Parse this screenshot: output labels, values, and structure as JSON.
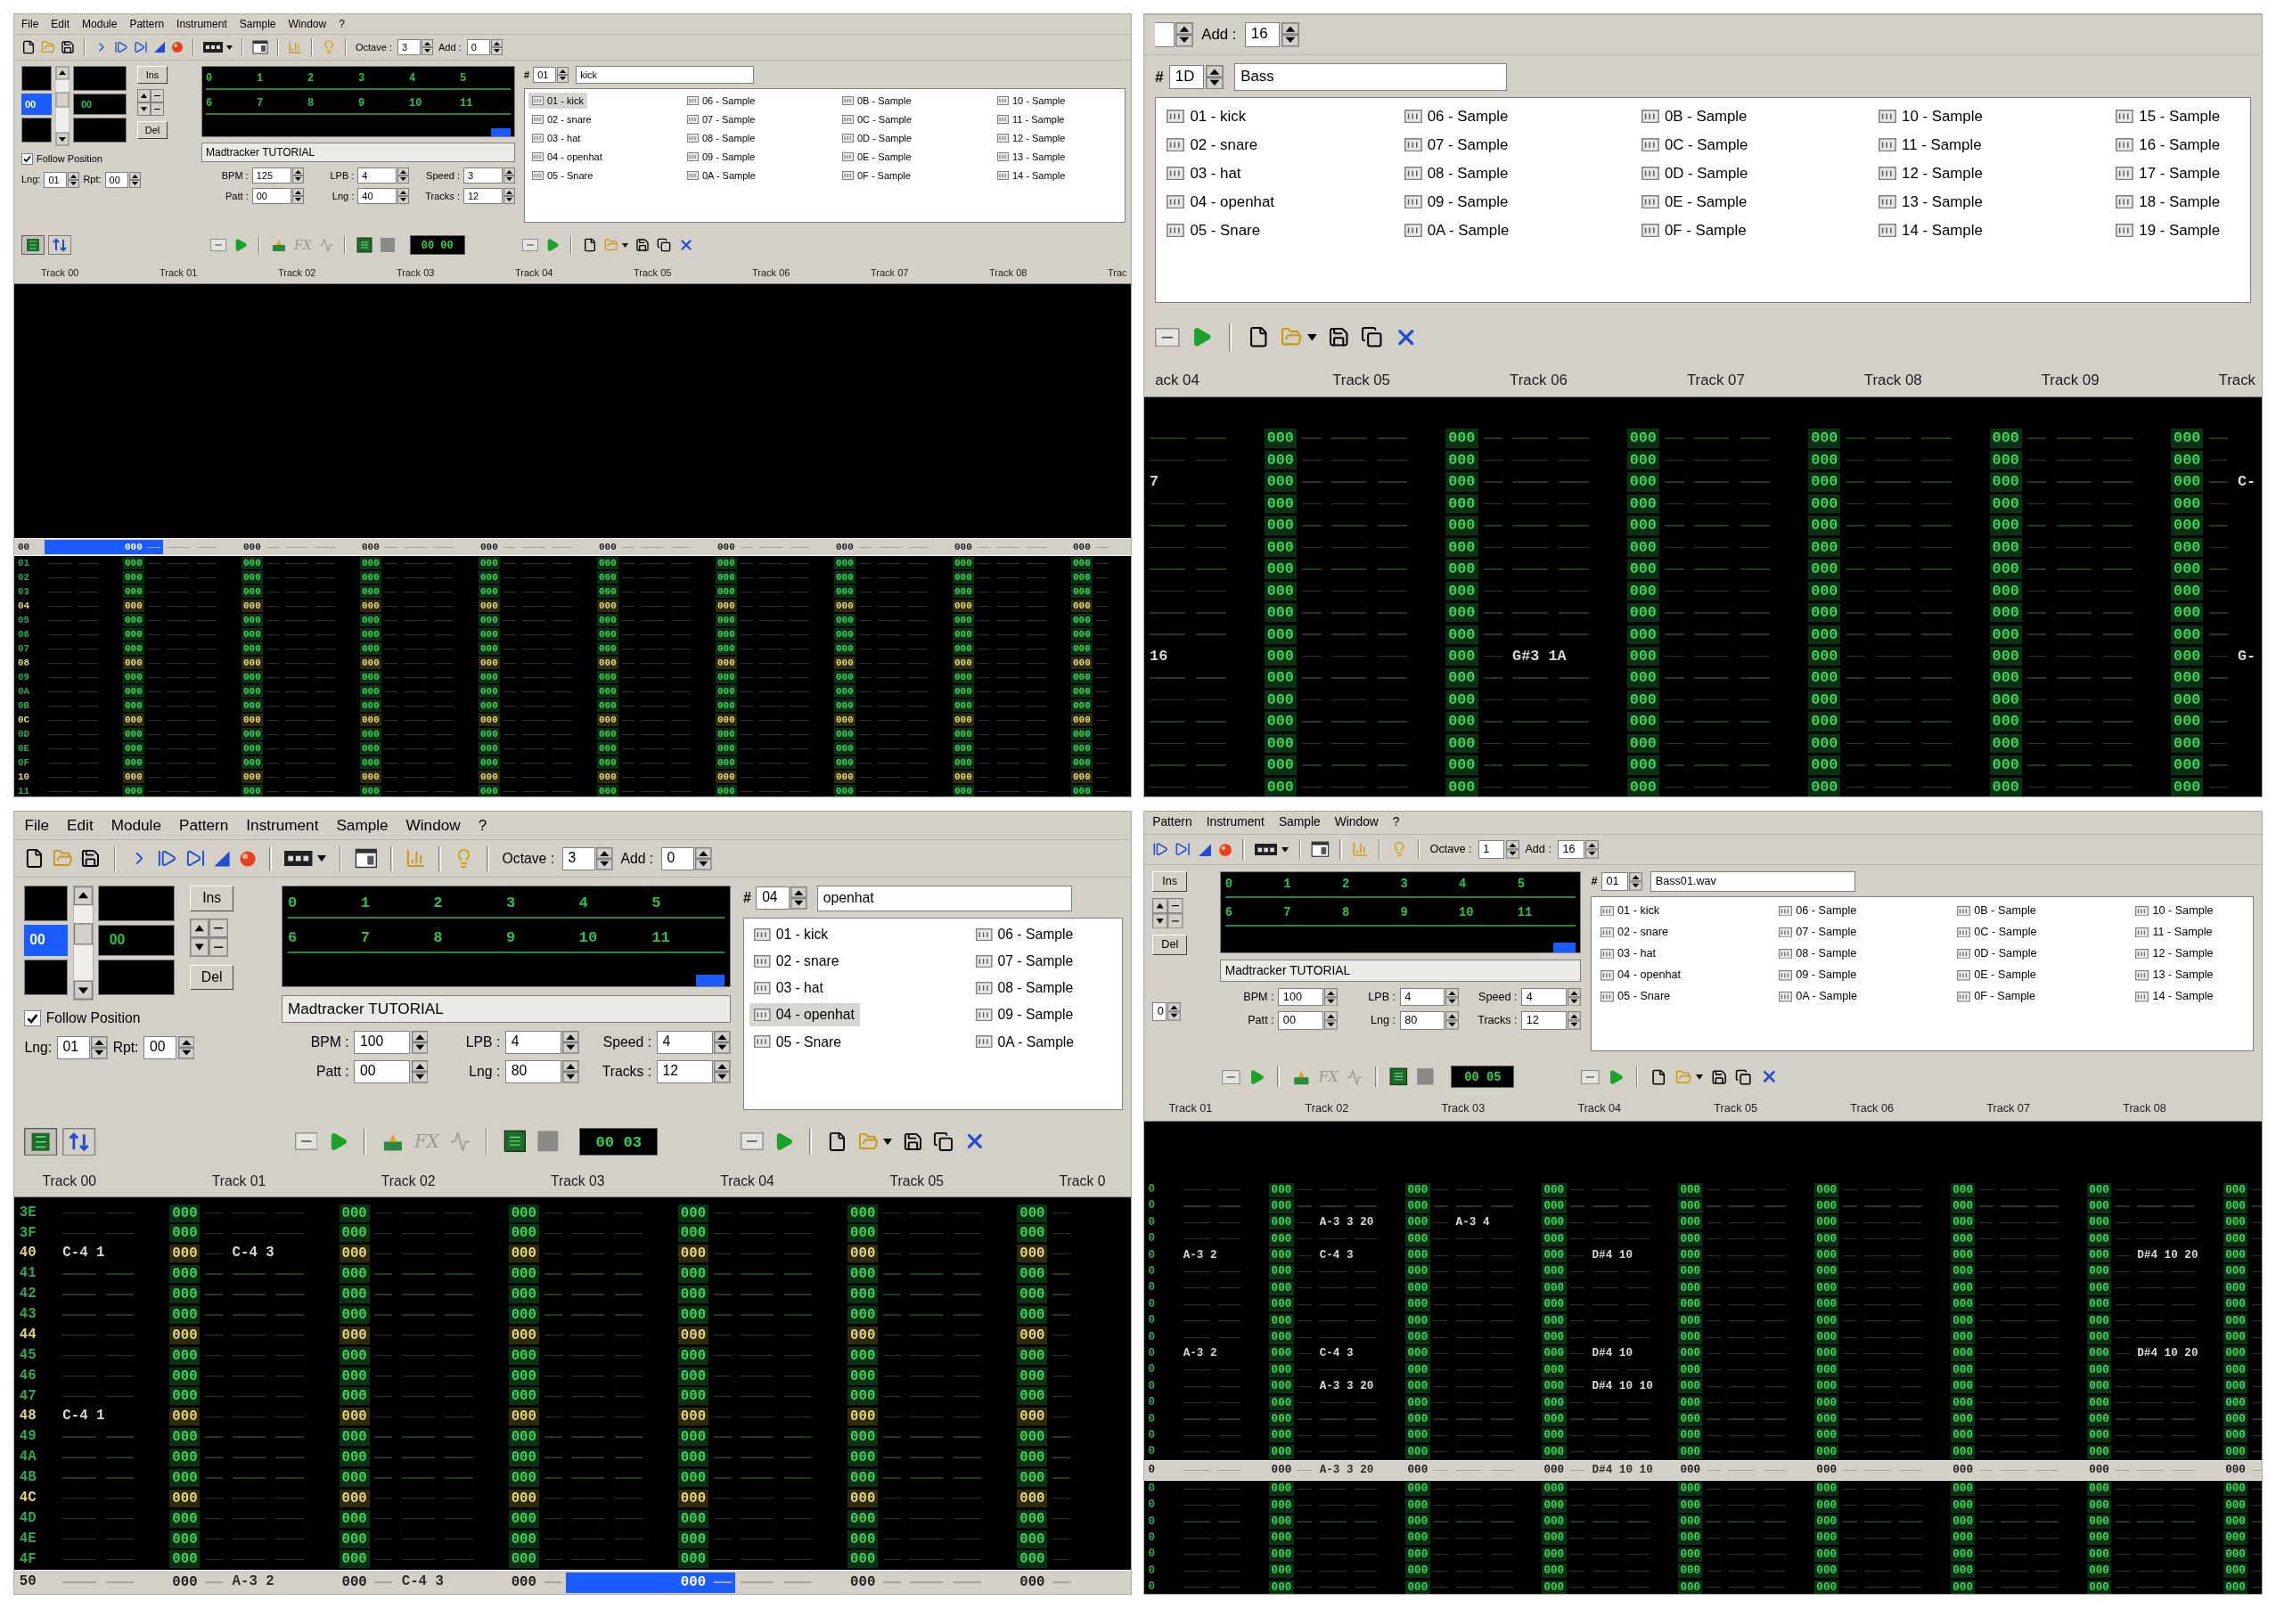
{
  "panels": [
    {
      "kind": "p1",
      "menu": [
        "File",
        "Edit",
        "Module",
        "Pattern",
        "Instrument",
        "Sample",
        "Window",
        "?"
      ],
      "toolbar": {
        "kind": "full",
        "octave_label": "Octave :",
        "octave": "3",
        "add_label": "Add :",
        "add": "0"
      },
      "controls": {
        "left": {
          "order_a": "00",
          "order_b": "00",
          "ins": "Ins",
          "del": "Del",
          "follow": {
            "label": "Follow Position",
            "checked": true
          },
          "lng_label": "Lng:",
          "lng": "01",
          "rpt_label": "Rpt:",
          "rpt": "00"
        },
        "song": {
          "orders": [
            "0",
            "1",
            "2",
            "3",
            "4",
            "5",
            "6",
            "7",
            "8",
            "9",
            "10",
            "11"
          ],
          "name": "Madtracker TUTORIAL",
          "params": [
            {
              "label": "BPM :",
              "value": "125"
            },
            {
              "label": "LPB :",
              "value": "4"
            },
            {
              "label": "Speed :",
              "value": "3"
            },
            {
              "label": "Patt :",
              "value": "00"
            },
            {
              "label": "Lng :",
              "value": "40"
            },
            {
              "label": "Tracks :",
              "value": "12"
            }
          ]
        },
        "instruments": {
          "number_label": "#",
          "number": "01",
          "name": "kick",
          "items": [
            {
              "label": "01 - kick",
              "selected": true
            },
            {
              "label": "02 - snare",
              "selected": false
            },
            {
              "label": "03 - hat",
              "selected": false
            },
            {
              "label": "04 - openhat",
              "selected": false
            },
            {
              "label": "05 - Snare",
              "selected": false
            },
            {
              "label": "06 - Sample",
              "selected": false
            },
            {
              "label": "07 - Sample",
              "selected": false
            },
            {
              "label": "08 - Sample",
              "selected": false
            },
            {
              "label": "09 - Sample",
              "selected": false
            },
            {
              "label": "0A - Sample",
              "selected": false
            },
            {
              "label": "0B - Sample",
              "selected": false
            },
            {
              "label": "0C - Sample",
              "selected": false
            },
            {
              "label": "0D - Sample",
              "selected": false
            },
            {
              "label": "0E - Sample",
              "selected": false
            },
            {
              "label": "0F - Sample",
              "selected": false
            },
            {
              "label": "10 - Sample",
              "selected": false
            },
            {
              "label": "11 - Sample",
              "selected": false
            },
            {
              "label": "12 - Sample",
              "selected": false
            },
            {
              "label": "13 - Sample",
              "selected": false
            },
            {
              "label": "14 - Sample",
              "selected": false
            }
          ]
        }
      },
      "toolbar2": {
        "kind": "full",
        "fx_label": "FX",
        "time": "00 00"
      },
      "headers": [
        "Track 00",
        "Track 01",
        "Track 02",
        "Track 03",
        "Track 04",
        "Track 05",
        "Track 06",
        "Track 07",
        "Track 08",
        "Trac"
      ],
      "pattern": {
        "current": {
          "num": "00",
          "cells": [
            {
              "kind": "cursor",
              "fx": "000"
            },
            "000",
            "000",
            "000",
            "000",
            "000",
            "000",
            "000",
            "000"
          ]
        },
        "rows_below": [
          {
            "num": "01",
            "highlight": false,
            "cells": [
              "000",
              "000",
              "000",
              "000",
              "000",
              "000",
              "000",
              "000",
              "000"
            ]
          },
          {
            "num": "02",
            "highlight": false,
            "cells": [
              "000",
              "000",
              "000",
              "000",
              "000",
              "000",
              "000",
              "000",
              "000"
            ]
          },
          {
            "num": "03",
            "highlight": false,
            "cells": [
              "000",
              "000",
              "000",
              "000",
              "000",
              "000",
              "000",
              "000",
              "000"
            ]
          },
          {
            "num": "04",
            "highlight": true,
            "cells": [
              "000",
              "000",
              "000",
              "000",
              "000",
              "000",
              "000",
              "000",
              "000"
            ]
          },
          {
            "num": "05",
            "highlight": false,
            "cells": [
              "000",
              "000",
              "000",
              "000",
              "000",
              "000",
              "000",
              "000",
              "000"
            ]
          },
          {
            "num": "06",
            "highlight": false,
            "cells": [
              "000",
              "000",
              "000",
              "000",
              "000",
              "000",
              "000",
              "000",
              "000"
            ]
          },
          {
            "num": "07",
            "highlight": false,
            "cells": [
              "000",
              "000",
              "000",
              "000",
              "000",
              "000",
              "000",
              "000",
              "000"
            ]
          },
          {
            "num": "08",
            "highlight": true,
            "cells": [
              "000",
              "000",
              "000",
              "000",
              "000",
              "000",
              "000",
              "000",
              "000"
            ]
          },
          {
            "num": "09",
            "highlight": false,
            "cells": [
              "000",
              "000",
              "000",
              "000",
              "000",
              "000",
              "000",
              "000",
              "000"
            ]
          },
          {
            "num": "0A",
            "highlight": false,
            "cells": [
              "000",
              "000",
              "000",
              "000",
              "000",
              "000",
              "000",
              "000",
              "000"
            ]
          },
          {
            "num": "0B",
            "highlight": false,
            "cells": [
              "000",
              "000",
              "000",
              "000",
              "000",
              "000",
              "000",
              "000",
              "000"
            ]
          },
          {
            "num": "0C",
            "highlight": true,
            "cells": [
              "000",
              "000",
              "000",
              "000",
              "000",
              "000",
              "000",
              "000",
              "000"
            ]
          },
          {
            "num": "0D",
            "highlight": false,
            "cells": [
              "000",
              "000",
              "000",
              "000",
              "000",
              "000",
              "000",
              "000",
              "000"
            ]
          },
          {
            "num": "0E",
            "highlight": false,
            "cells": [
              "000",
              "000",
              "000",
              "000",
              "000",
              "000",
              "000",
              "000",
              "000"
            ]
          },
          {
            "num": "0F",
            "highlight": false,
            "cells": [
              "000",
              "000",
              "000",
              "000",
              "000",
              "000",
              "000",
              "000",
              "000"
            ]
          },
          {
            "num": "10",
            "highlight": true,
            "cells": [
              "000",
              "000",
              "000",
              "000",
              "000",
              "000",
              "000",
              "000",
              "000"
            ]
          },
          {
            "num": "11",
            "highlight": false,
            "cells": [
              "000",
              "000",
              "000",
              "000",
              "000",
              "000",
              "000",
              "000",
              "000"
            ]
          }
        ]
      }
    },
    {
      "kind": "p2",
      "toolbar": {
        "kind": "add_only",
        "add_label": "Add :",
        "add": "16"
      },
      "controls": {
        "instruments": {
          "number_label": "#",
          "number": "1D",
          "name": "Bass",
          "items": [
            {
              "label": "01 - kick",
              "selected": false
            },
            {
              "label": "02 - snare",
              "selected": false
            },
            {
              "label": "03 - hat",
              "selected": false
            },
            {
              "label": "04 - openhat",
              "selected": false
            },
            {
              "label": "05 - Snare",
              "selected": false
            },
            {
              "label": "06 - Sample",
              "selected": false
            },
            {
              "label": "07 - Sample",
              "selected": false
            },
            {
              "label": "08 - Sample",
              "selected": false
            },
            {
              "label": "09 - Sample",
              "selected": false
            },
            {
              "label": "0A - Sample",
              "selected": false
            },
            {
              "label": "0B - Sample",
              "selected": false
            },
            {
              "label": "0C - Sample",
              "selected": false
            },
            {
              "label": "0D - Sample",
              "selected": false
            },
            {
              "label": "0E - Sample",
              "selected": false
            },
            {
              "label": "0F - Sample",
              "selected": false
            },
            {
              "label": "10 - Sample",
              "selected": false
            },
            {
              "label": "11 - Sample",
              "selected": false
            },
            {
              "label": "12 - Sample",
              "selected": false
            },
            {
              "label": "13 - Sample",
              "selected": false
            },
            {
              "label": "14 - Sample",
              "selected": false
            },
            {
              "label": "15 - Sample",
              "selected": false
            },
            {
              "label": "16 - Sample",
              "selected": false
            },
            {
              "label": "17 - Sample",
              "selected": false
            },
            {
              "label": "18 - Sample",
              "selected": false
            },
            {
              "label": "19 - Sample",
              "selected": false
            }
          ]
        }
      },
      "toolbar2": {
        "kind": "inst_only"
      },
      "headers": [
        "ack 04",
        "Track 05",
        "Track 06",
        "Track 07",
        "Track 08",
        "Track 09",
        "Track"
      ],
      "pattern": {
        "rows_above": [
          {
            "cells": [
              "000",
              "000",
              "000",
              "000",
              "000",
              "000"
            ]
          },
          {
            "cells": [
              "000",
              "000",
              "000",
              "000",
              "000",
              "000"
            ]
          },
          {
            "cells": [
              {
                "note": "7",
                "fx": "000"
              },
              "000",
              "000",
              "000",
              "000",
              "000",
              {
                "note": "C-"
              }
            ]
          },
          {
            "cells": [
              "000",
              "000",
              "000",
              "000",
              "000",
              "000"
            ]
          },
          {
            "cells": [
              "000",
              "000",
              "000",
              "000",
              "000",
              "000"
            ]
          },
          {
            "cells": [
              "000",
              "000",
              "000",
              "000",
              "000",
              "000"
            ]
          },
          {
            "cells": [
              "000",
              "000",
              "000",
              "000",
              "000",
              "000"
            ]
          },
          {
            "cells": [
              "000",
              "000",
              "000",
              "000",
              "000",
              "000"
            ]
          },
          {
            "cells": [
              "000",
              "000",
              "000",
              "000",
              "000",
              "000"
            ]
          },
          {
            "cells": [
              "000",
              "000",
              "000",
              "000",
              "000",
              "000"
            ]
          },
          {
            "cells": [
              {
                "note": "16",
                "fx": "000"
              },
              "000",
              {
                "note": "G#3 1A",
                "fx": "000"
              },
              "000",
              "000",
              "000",
              {
                "note": "G-"
              }
            ]
          },
          {
            "cells": [
              "000",
              "000",
              "000",
              "000",
              "000",
              "000"
            ]
          },
          {
            "cells": [
              "000",
              "000",
              "000",
              "000",
              "000",
              "000"
            ]
          },
          {
            "cells": [
              "000",
              "000",
              "000",
              "000",
              "000",
              "000"
            ]
          },
          {
            "cells": [
              "000",
              "000",
              "000",
              "000",
              "000",
              "000"
            ]
          },
          {
            "cells": [
              "000",
              "000",
              "000",
              "000",
              "000",
              "000"
            ]
          },
          {
            "cells": [
              "000",
              "000",
              "000",
              "000",
              "000",
              "000"
            ]
          }
        ]
      }
    },
    {
      "kind": "p3",
      "menu": [
        "File",
        "Edit",
        "Module",
        "Pattern",
        "Instrument",
        "Sample",
        "Window",
        "?"
      ],
      "toolbar": {
        "kind": "full",
        "octave_label": "Octave :",
        "octave": "3",
        "add_label": "Add :",
        "add": "0"
      },
      "controls": {
        "left": {
          "order_a": "00",
          "order_b": "00",
          "ins": "Ins",
          "del": "Del",
          "follow": {
            "label": "Follow Position",
            "checked": true
          },
          "lng_label": "Lng:",
          "lng": "01",
          "rpt_label": "Rpt:",
          "rpt": "00"
        },
        "song": {
          "orders": [
            "0",
            "1",
            "2",
            "3",
            "4",
            "5",
            "6",
            "7",
            "8",
            "9",
            "10",
            "11"
          ],
          "name": "Madtracker TUTORIAL",
          "params": [
            {
              "label": "BPM :",
              "value": "100"
            },
            {
              "label": "LPB :",
              "value": "4"
            },
            {
              "label": "Speed :",
              "value": "4"
            },
            {
              "label": "Patt :",
              "value": "00"
            },
            {
              "label": "Lng :",
              "value": "80"
            },
            {
              "label": "Tracks :",
              "value": "12"
            }
          ]
        },
        "instruments": {
          "number_label": "#",
          "number": "04",
          "name": "openhat",
          "items": [
            {
              "label": "01 - kick",
              "selected": false
            },
            {
              "label": "02 - snare",
              "selected": false
            },
            {
              "label": "03 - hat",
              "selected": false
            },
            {
              "label": "04 - openhat",
              "selected": true
            },
            {
              "label": "05 - Snare",
              "selected": false
            },
            {
              "label": "06 - Sample",
              "selected": false
            },
            {
              "label": "07 - Sample",
              "selected": false
            },
            {
              "label": "08 - Sample",
              "selected": false
            },
            {
              "label": "09 - Sample",
              "selected": false
            },
            {
              "label": "0A - Sample",
              "selected": false
            }
          ]
        }
      },
      "toolbar2": {
        "kind": "full",
        "fx_label": "FX",
        "time": "00 03"
      },
      "headers": [
        "Track 00",
        "Track 01",
        "Track 02",
        "Track 03",
        "Track 04",
        "Track 05",
        "Track 0"
      ],
      "pattern": {
        "rows_above": [
          {
            "num": "3E",
            "highlight": false,
            "cells": [
              "000",
              "000",
              "000",
              "000",
              "000",
              "000"
            ]
          },
          {
            "num": "3F",
            "highlight": false,
            "cells": [
              "000",
              "000",
              "000",
              "000",
              "000",
              "000"
            ]
          },
          {
            "num": "40",
            "highlight": true,
            "cells": [
              {
                "note": "C-4 1",
                "fx": "000"
              },
              {
                "note": "C-4 3",
                "fx": "000"
              },
              "000",
              "000",
              "000",
              "000"
            ]
          },
          {
            "num": "41",
            "highlight": false,
            "cells": [
              "000",
              "000",
              "000",
              "000",
              "000",
              "000"
            ]
          },
          {
            "num": "42",
            "highlight": false,
            "cells": [
              "000",
              "000",
              "000",
              "000",
              "000",
              "000"
            ]
          },
          {
            "num": "43",
            "highlight": false,
            "cells": [
              "000",
              "000",
              "000",
              "000",
              "000",
              "000"
            ]
          },
          {
            "num": "44",
            "highlight": true,
            "cells": [
              "000",
              "000",
              "000",
              "000",
              "000",
              "000"
            ]
          },
          {
            "num": "45",
            "highlight": false,
            "cells": [
              "000",
              "000",
              "000",
              "000",
              "000",
              "000"
            ]
          },
          {
            "num": "46",
            "highlight": false,
            "cells": [
              "000",
              "000",
              "000",
              "000",
              "000",
              "000"
            ]
          },
          {
            "num": "47",
            "highlight": false,
            "cells": [
              "000",
              "000",
              "000",
              "000",
              "000",
              "000"
            ]
          },
          {
            "num": "48",
            "highlight": true,
            "cells": [
              {
                "note": "C-4 1",
                "fx": "000"
              },
              "000",
              "000",
              "000",
              "000",
              "000"
            ]
          },
          {
            "num": "49",
            "highlight": false,
            "cells": [
              "000",
              "000",
              "000",
              "000",
              "000",
              "000"
            ]
          },
          {
            "num": "4A",
            "highlight": false,
            "cells": [
              "000",
              "000",
              "000",
              "000",
              "000",
              "000"
            ]
          },
          {
            "num": "4B",
            "highlight": false,
            "cells": [
              "000",
              "000",
              "000",
              "000",
              "000",
              "000"
            ]
          },
          {
            "num": "4C",
            "highlight": true,
            "cells": [
              "000",
              "000",
              "000",
              "000",
              "000",
              "000"
            ]
          },
          {
            "num": "4D",
            "highlight": false,
            "cells": [
              "000",
              "000",
              "000",
              "000",
              "000",
              "000"
            ]
          },
          {
            "num": "4E",
            "highlight": false,
            "cells": [
              "000",
              "000",
              "000",
              "000",
              "000",
              "000"
            ]
          },
          {
            "num": "4F",
            "highlight": false,
            "cells": [
              "000",
              "000",
              "000",
              "000",
              "000",
              "000"
            ]
          }
        ],
        "current": {
          "num": "50",
          "cells": [
            "000",
            {
              "note": "A-3 2",
              "fx": "000"
            },
            {
              "note": "C-4 3",
              "fx": "000"
            },
            {
              "kind": "cursor",
              "fx": "000"
            },
            "000",
            "000"
          ]
        }
      }
    },
    {
      "kind": "p4",
      "menu": [
        "Pattern",
        "Instrument",
        "Sample",
        "Window",
        "?"
      ],
      "toolbar": {
        "kind": "cropped",
        "octave_label": "Octave :",
        "octave": "1",
        "add_label": "Add :",
        "add": "16"
      },
      "controls": {
        "edit": {
          "ins": "Ins",
          "del": "Del",
          "stub": "0"
        },
        "song": {
          "orders": [
            "0",
            "1",
            "2",
            "3",
            "4",
            "5",
            "6",
            "7",
            "8",
            "9",
            "10",
            "11"
          ],
          "name": "Madtracker TUTORIAL",
          "params": [
            {
              "label": "BPM :",
              "value": "100"
            },
            {
              "label": "LPB :",
              "value": "4"
            },
            {
              "label": "Speed :",
              "value": "4"
            },
            {
              "label": "Patt :",
              "value": "00"
            },
            {
              "label": "Lng :",
              "value": "80"
            },
            {
              "label": "Tracks :",
              "value": "12"
            }
          ]
        },
        "instruments": {
          "number_label": "#",
          "number": "01",
          "name": "Bass01.wav",
          "items": [
            {
              "label": "01 - kick",
              "selected": false
            },
            {
              "label": "02 - snare",
              "selected": false
            },
            {
              "label": "03 - hat",
              "selected": false
            },
            {
              "label": "04 - openhat",
              "selected": false
            },
            {
              "label": "05 - Snare",
              "selected": false
            },
            {
              "label": "06 - Sample",
              "selected": false
            },
            {
              "label": "07 - Sample",
              "selected": false
            },
            {
              "label": "08 - Sample",
              "selected": false
            },
            {
              "label": "09 - Sample",
              "selected": false
            },
            {
              "label": "0A - Sample",
              "selected": false
            },
            {
              "label": "0B - Sample",
              "selected": false
            },
            {
              "label": "0C - Sample",
              "selected": false
            },
            {
              "label": "0D - Sample",
              "selected": false
            },
            {
              "label": "0E - Sample",
              "selected": false
            },
            {
              "label": "0F - Sample",
              "selected": false
            },
            {
              "label": "10 - Sample",
              "selected": false
            },
            {
              "label": "11 - Sample",
              "selected": false
            },
            {
              "label": "12 - Sample",
              "selected": false
            },
            {
              "label": "13 - Sample",
              "selected": false
            },
            {
              "label": "14 - Sample",
              "selected": false
            }
          ]
        }
      },
      "toolbar2": {
        "kind": "no_left",
        "fx_label": "FX",
        "time": "00 05"
      },
      "headers": [
        "Track 01",
        "Track 02",
        "Track 03",
        "Track 04",
        "Track 05",
        "Track 06",
        "Track 07",
        "Track 08"
      ],
      "pattern": {
        "rows_above": [
          {
            "num": "0",
            "highlight": false,
            "cells": [
              "000",
              "000",
              "000",
              "000",
              "000",
              "000",
              "000",
              "000"
            ]
          },
          {
            "num": "0",
            "highlight": false,
            "cells": [
              "000",
              "000",
              "000",
              "000",
              "000",
              "000",
              "000",
              "000"
            ]
          },
          {
            "num": "0",
            "highlight": false,
            "cells": [
              "000",
              {
                "note": "A-3 3 20",
                "fx": "000"
              },
              {
                "note": "A-3 4",
                "fx": "000"
              },
              "000",
              "000",
              "000",
              "000",
              "000"
            ]
          },
          {
            "num": "0",
            "highlight": false,
            "cells": [
              "000",
              "000",
              "000",
              "000",
              "000",
              "000",
              "000",
              "000"
            ]
          },
          {
            "num": "0",
            "highlight": false,
            "cells": [
              {
                "note": "A-3 2",
                "fx": "000"
              },
              {
                "note": "C-4 3",
                "fx": "000"
              },
              "000",
              {
                "note": "D#4 10",
                "fx": "000"
              },
              "000",
              "000",
              "000",
              {
                "note": "D#4 10 20",
                "fx": "000"
              }
            ]
          },
          {
            "num": "0",
            "highlight": false,
            "cells": [
              "000",
              "000",
              "000",
              "000",
              "000",
              "000",
              "000",
              "000"
            ]
          },
          {
            "num": "0",
            "highlight": false,
            "cells": [
              "000",
              "000",
              "000",
              "000",
              "000",
              "000",
              "000",
              "000"
            ]
          },
          {
            "num": "0",
            "highlight": false,
            "cells": [
              "000",
              "000",
              "000",
              "000",
              "000",
              "000",
              "000",
              "000"
            ]
          },
          {
            "num": "0",
            "highlight": false,
            "cells": [
              "000",
              "000",
              "000",
              "000",
              "000",
              "000",
              "000",
              "000"
            ]
          },
          {
            "num": "0",
            "highlight": false,
            "cells": [
              "000",
              "000",
              "000",
              "000",
              "000",
              "000",
              "000",
              "000"
            ]
          },
          {
            "num": "0",
            "highlight": false,
            "cells": [
              {
                "note": "A-3 2",
                "fx": "000"
              },
              {
                "note": "C-4 3",
                "fx": "000"
              },
              "000",
              {
                "note": "D#4 10",
                "fx": "000"
              },
              "000",
              "000",
              "000",
              {
                "note": "D#4 10 20",
                "fx": "000"
              }
            ]
          },
          {
            "num": "0",
            "highlight": false,
            "cells": [
              "000",
              "000",
              "000",
              "000",
              "000",
              "000",
              "000",
              "000"
            ]
          },
          {
            "num": "0",
            "highlight": false,
            "cells": [
              "000",
              {
                "note": "A-3 3 20",
                "fx": "000"
              },
              "000",
              {
                "note": "D#4 10 10",
                "fx": "000"
              },
              "000",
              "000",
              "000",
              "000"
            ]
          },
          {
            "num": "0",
            "highlight": false,
            "cells": [
              "000",
              "000",
              "000",
              "000",
              "000",
              "000",
              "000",
              "000"
            ]
          },
          {
            "num": "0",
            "highlight": false,
            "cells": [
              "000",
              "000",
              "000",
              "000",
              "000",
              "000",
              "000",
              "000"
            ]
          },
          {
            "num": "0",
            "highlight": false,
            "cells": [
              "000",
              "000",
              "000",
              "000",
              "000",
              "000",
              "000",
              "000"
            ]
          },
          {
            "num": "0",
            "highlight": false,
            "cells": [
              "000",
              "000",
              "000",
              "000",
              "000",
              "000",
              "000",
              "000"
            ]
          }
        ],
        "current": {
          "num": "0",
          "cells": [
            "000",
            {
              "note": "A-3 3 20",
              "fx": "000"
            },
            "000",
            {
              "note": "D#4 10 10",
              "fx": "000"
            },
            "000",
            "000",
            "000",
            "000"
          ]
        },
        "rows_below": [
          {
            "num": "0",
            "highlight": false,
            "cells": [
              "000",
              "000",
              "000",
              "000",
              "000",
              "000",
              "000",
              "000"
            ]
          },
          {
            "num": "0",
            "highlight": false,
            "cells": [
              "000",
              "000",
              "000",
              "000",
              "000",
              "000",
              "000",
              "000"
            ]
          },
          {
            "num": "0",
            "highlight": false,
            "cells": [
              "000",
              "000",
              "000",
              "000",
              "000",
              "000",
              "000",
              "000"
            ]
          },
          {
            "num": "0",
            "highlight": false,
            "cells": [
              "000",
              "000",
              "000",
              "000",
              "000",
              "000",
              "000",
              "000"
            ]
          },
          {
            "num": "0",
            "highlight": false,
            "cells": [
              "000",
              "000",
              "000",
              "000",
              "000",
              "000",
              "000",
              "000"
            ]
          },
          {
            "num": "0",
            "highlight": false,
            "cells": [
              "000",
              "000",
              "000",
              "000",
              "000",
              "000",
              "000",
              "000"
            ]
          },
          {
            "num": "0",
            "highlight": false,
            "cells": [
              "000",
              "000",
              "000",
              "000",
              "000",
              "000",
              "000",
              "000"
            ]
          }
        ]
      }
    }
  ]
}
